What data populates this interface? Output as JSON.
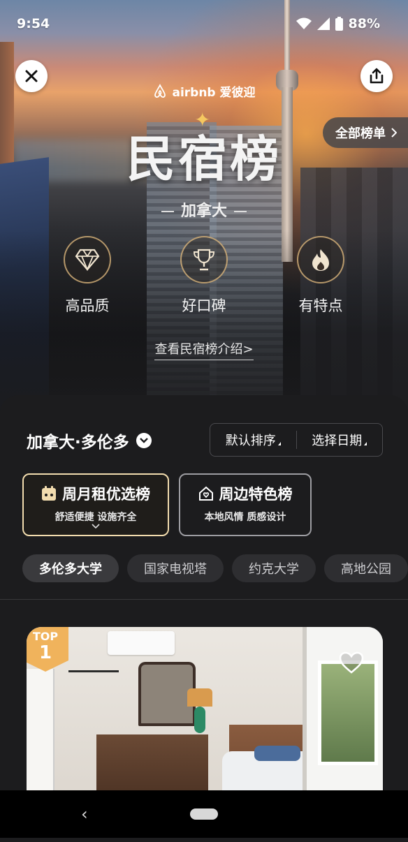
{
  "status_bar": {
    "time": "9:54",
    "battery": "88%"
  },
  "brand": {
    "logo_text": "airbnb 爱彼迎"
  },
  "hero": {
    "title": "民宿榜",
    "region": "加拿大",
    "all_lists_label": "全部榜单",
    "features": [
      {
        "label": "高品质",
        "icon": "diamond-icon"
      },
      {
        "label": "好口碑",
        "icon": "trophy-icon"
      },
      {
        "label": "有特点",
        "icon": "flame-icon"
      }
    ],
    "intro_link": "查看民宿榜介绍>"
  },
  "filters": {
    "city": "加拿大·多伦多",
    "sort_label": "默认排序",
    "date_label": "选择日期"
  },
  "list_cards": [
    {
      "title": "周月租优选榜",
      "subtitle": "舒适便捷 设施齐全",
      "icon": "calendar-icon"
    },
    {
      "title": "周边特色榜",
      "subtitle": "本地风情 质感设计",
      "icon": "house-icon"
    }
  ],
  "chips": [
    "多伦多大学",
    "国家电视塔",
    "约克大学",
    "高地公园"
  ],
  "listing": {
    "badge_top": "TOP",
    "badge_rank": "1"
  },
  "colors": {
    "accent_gold": "#f2dcae",
    "badge_orange": "#f0b35c",
    "panel_bg": "#1c1c1e"
  }
}
